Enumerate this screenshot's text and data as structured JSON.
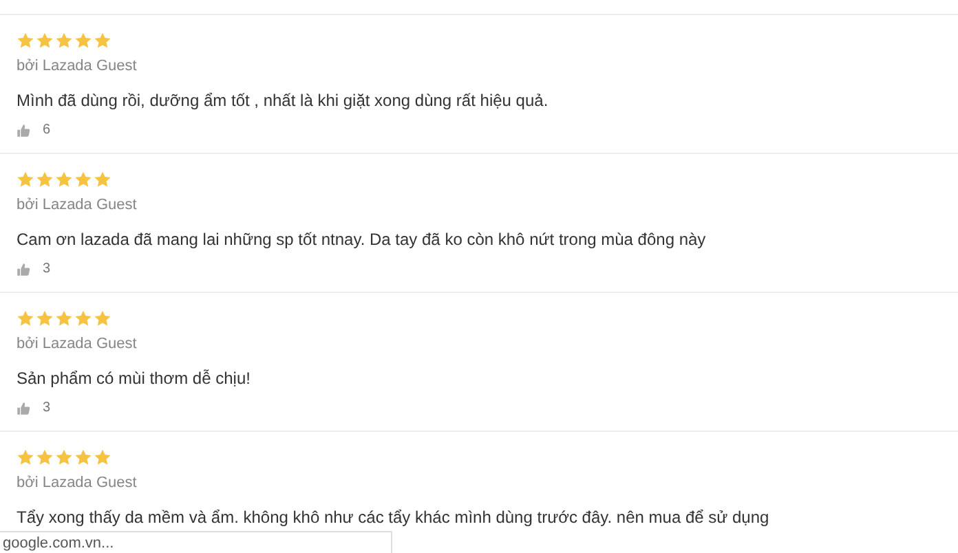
{
  "reviews": [
    {
      "stars": 5,
      "author": "bởi Lazada Guest",
      "text": "Mình đã dùng rồi, dưỡng ẩm tốt , nhất là khi giặt xong dùng rất hiệu quả.",
      "likes": "6"
    },
    {
      "stars": 5,
      "author": "bởi Lazada Guest",
      "text": "Cam ơn lazada đã mang lai những sp tốt ntnay. Da tay đã ko còn khô nứt trong mùa đông này",
      "likes": "3"
    },
    {
      "stars": 5,
      "author": "bởi Lazada Guest",
      "text": "Sản phẩm có mùi thơm dễ chịu!",
      "likes": "3"
    },
    {
      "stars": 5,
      "author": "bởi Lazada Guest",
      "text": "Tẩy xong thấy da mềm và ẩm. không khô như các tẩy khác mình dùng trước đây. nên mua để sử dụng"
    }
  ],
  "status_bar": {
    "url": "google.com.vn..."
  }
}
